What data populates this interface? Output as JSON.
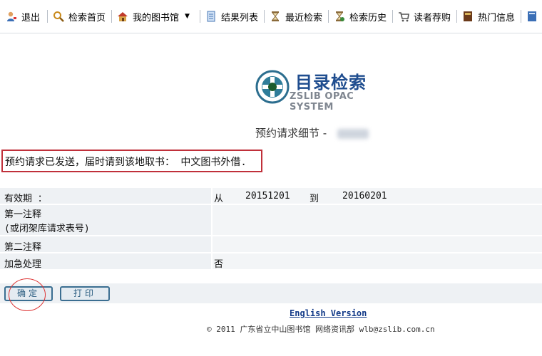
{
  "toolbar": {
    "items": [
      {
        "label": "退出",
        "icon": "user-exit-icon"
      },
      {
        "label": "检索首页",
        "icon": "search-icon"
      },
      {
        "label": "我的图书馆",
        "icon": "home-icon"
      },
      {
        "label": "结果列表",
        "icon": "document-list-icon"
      },
      {
        "label": "最近检索",
        "icon": "hourglass-icon"
      },
      {
        "label": "检索历史",
        "icon": "history-icon"
      },
      {
        "label": "读者荐购",
        "icon": "cart-icon"
      },
      {
        "label": "热门信息",
        "icon": "book-icon"
      }
    ],
    "dropdown_caret": "▼"
  },
  "logo": {
    "title": "目录检索",
    "subtitle": "ZSLIB OPAC SYSTEM"
  },
  "page": {
    "title": "预约请求细节 -"
  },
  "notice": {
    "text": "预约请求已发送，届时请到该地取书： 中文图书外借."
  },
  "details": {
    "validity_label": "有效期 ：",
    "from_label": "从",
    "from_date": "20151201",
    "to_label": "到",
    "to_date": "20160201",
    "note1_label": "第一注释",
    "note1_sub": "(或闭架库请求表号)",
    "note2_label": "第二注释",
    "urgent_label": "加急处理",
    "urgent_value": "否"
  },
  "buttons": {
    "confirm": "确定",
    "print": "打印"
  },
  "footer": {
    "english_link": "English Version",
    "copyright": "© 2011 广东省立中山图书馆 网络资讯部 wlb@zslib.com.cn"
  },
  "colors": {
    "brand": "#1f4d8f",
    "notice_border": "#c0303a",
    "button_border": "#3b6e91"
  }
}
